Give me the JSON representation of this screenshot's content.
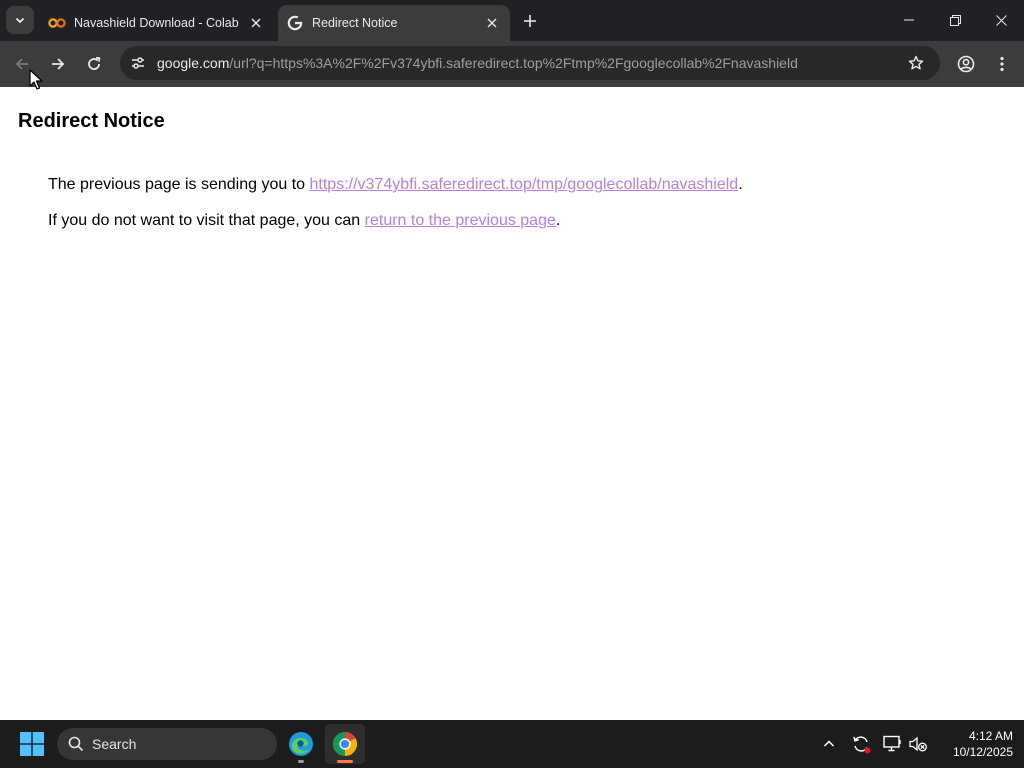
{
  "tabs": {
    "inactive": {
      "title": "Navashield Download - Colab",
      "favicon": "colab-icon"
    },
    "active": {
      "title": "Redirect Notice",
      "favicon": "google-icon"
    }
  },
  "toolbar": {
    "url_host": "google.com",
    "url_rest": "/url?q=https%3A%2F%2Fv374ybfi.saferedirect.top%2Ftmp%2Fgooglecollab%2Fnavashield"
  },
  "page": {
    "heading": "Redirect Notice",
    "line1_prefix": "The previous page is sending you to ",
    "line1_link": "https://v374ybfi.saferedirect.top/tmp/googlecollab/navashield",
    "line1_suffix": ".",
    "line2_prefix": "If you do not want to visit that page, you can ",
    "line2_link": "return to the previous page",
    "line2_suffix": ".",
    "link_color": "#b67ee6"
  },
  "taskbar": {
    "search_label": "Search",
    "time": "4:12 AM",
    "date": "10/12/2025"
  }
}
